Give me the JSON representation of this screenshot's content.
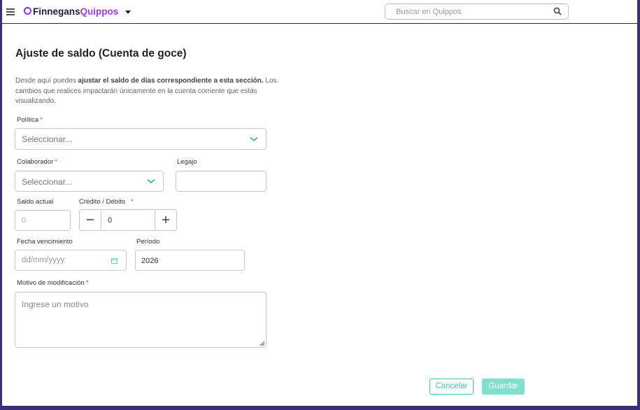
{
  "header": {
    "logo_part1": "Finnegans",
    "logo_part2": "Quippos",
    "search_placeholder": "Buscar en Quippos",
    "brand_color": "#9b3bf0"
  },
  "page": {
    "title": "Ajuste de saldo (Cuenta de goce)",
    "desc_prefix": "Desde aquí puedes ",
    "desc_bold": "ajustar el saldo de días correspondiente a esta sección.",
    "desc_suffix": " Los cambios que realices impactarán únicamente en la cuenta corriente que estás visualizando."
  },
  "form": {
    "politica": {
      "label": "Política",
      "required": "*",
      "placeholder": "Seleccionar..."
    },
    "colaborador": {
      "label": "Colaborador",
      "required": "*",
      "placeholder": "Seleccionar..."
    },
    "legajo": {
      "label": "Legajo",
      "value": ""
    },
    "saldo_actual": {
      "label": "Saldo actual",
      "placeholder": "0"
    },
    "credito_debito": {
      "label": "Crédito / Débito",
      "required": "*",
      "value": "0"
    },
    "fecha_vencimiento": {
      "label": "Fecha vencimiento",
      "placeholder": "dd/mm/yyyy"
    },
    "periodo": {
      "label": "Período",
      "value": "2026"
    },
    "motivo": {
      "label": "Motivo de modificación",
      "required": "*",
      "placeholder": "Ingrese un motivo"
    }
  },
  "actions": {
    "cancel_label": "Cancelar",
    "save_label": "Guardar",
    "accent_color": "#3ec7b0"
  }
}
